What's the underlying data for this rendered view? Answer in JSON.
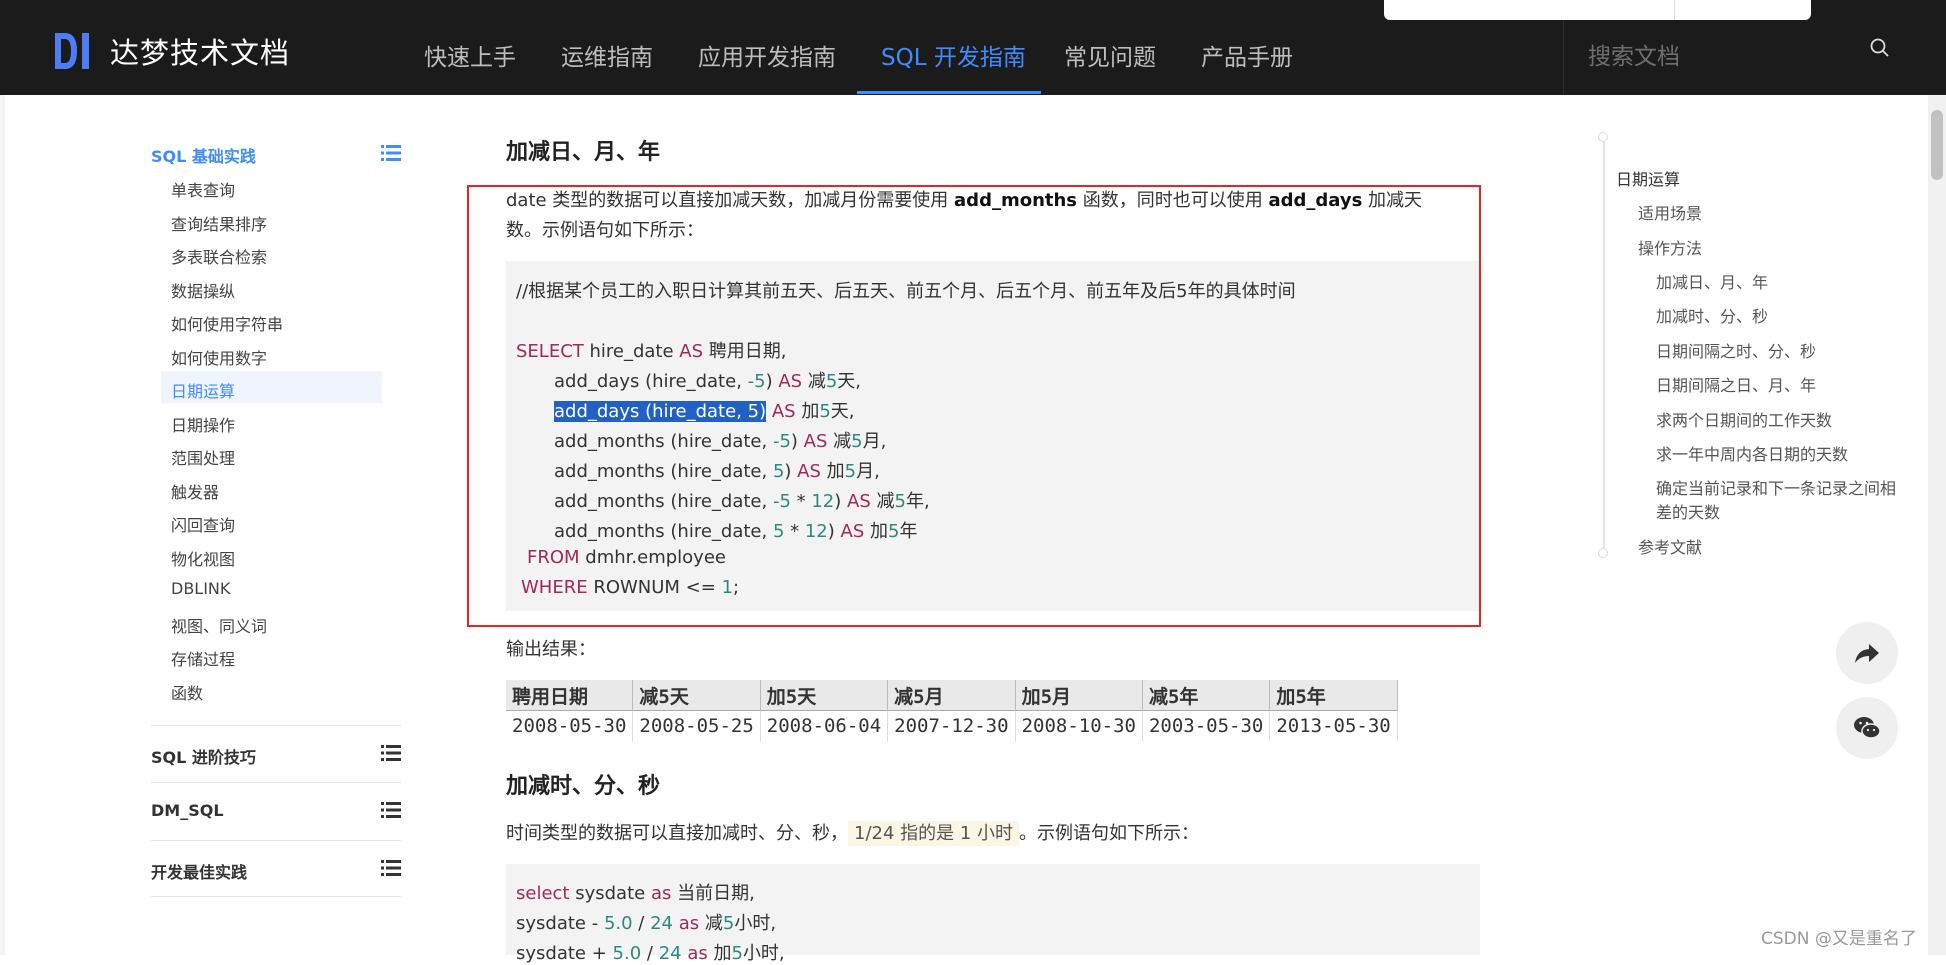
{
  "brand": {
    "name": "达梦技术文档"
  },
  "nav": {
    "items": [
      "快速上手",
      "运维指南",
      "应用开发指南",
      "SQL 开发指南",
      "常见问题",
      "产品手册"
    ],
    "active": "SQL 开发指南"
  },
  "search": {
    "placeholder": "搜索文档"
  },
  "sidebar": {
    "section1": "SQL 基础实践",
    "items": [
      "单表查询",
      "查询结果排序",
      "多表联合检索",
      "数据操纵",
      "如何使用字符串",
      "如何使用数字",
      "日期运算",
      "日期操作",
      "范围处理",
      "触发器",
      "闪回查询",
      "物化视图",
      "DBLINK",
      "视图、同义词",
      "存储过程",
      "函数"
    ],
    "active": "日期运算",
    "section2": "SQL 进阶技巧",
    "section3": "DM_SQL",
    "section4": "开发最佳实践"
  },
  "main": {
    "h1": "加减日、月、年",
    "p1_a": "date 类型的数据可以直接加减天数，加减月份需要使用 ",
    "p1_b": "add_months",
    "p1_c": " 函数，同时也可以使用 ",
    "p1_d": "add_days",
    "p1_e": " 加减天",
    "p1_line2": "数。示例语句如下所示：",
    "code1_comment": "//根据某个员工的入职日计算其前五天、后五天、前五个月、后五个月、前五年及后5年的具体时间",
    "output_label": "输出结果：",
    "table": {
      "headers": [
        "聘用日期",
        "减5天",
        "加5天",
        "减5月",
        "加5月",
        "减5年",
        "加5年"
      ],
      "row": [
        "2008-05-30",
        "2008-05-25",
        "2008-06-04",
        "2007-12-30",
        "2008-10-30",
        "2003-05-30",
        "2013-05-30"
      ]
    },
    "h2": "加减时、分、秒",
    "p2_a": "时间类型的数据可以直接加减时、分、秒，",
    "p2_hl": "1/24 指的是 1 小时",
    "p2_b": "。示例语句如下所示："
  },
  "toc": {
    "items": [
      "日期运算",
      "适用场景",
      "操作方法",
      "加减日、月、年",
      "加减时、分、秒",
      "日期间隔之时、分、秒",
      "日期间隔之日、月、年",
      "求两个日期间的工作天数",
      "求一年中周内各日期的天数",
      "确定当前记录和下一条记录之间相",
      "差的天数",
      "参考文献"
    ]
  },
  "watermark": "CSDN @又是重名了",
  "colors": {
    "accent": "#3f8cff",
    "highlight_box": "#e5252a",
    "nav_bg": "#1b1b1b"
  }
}
